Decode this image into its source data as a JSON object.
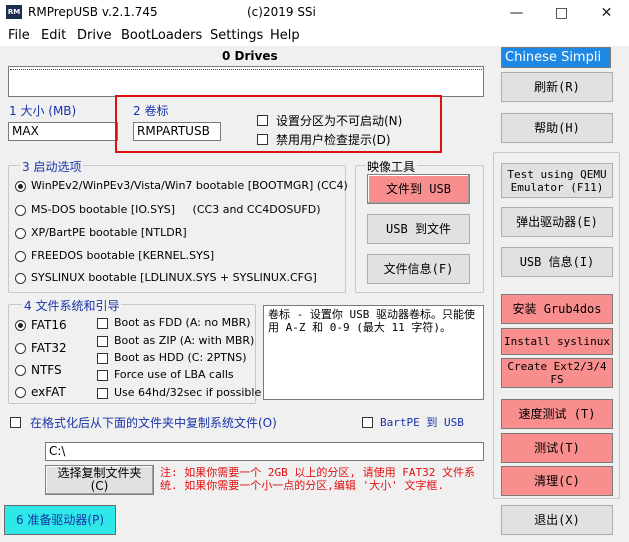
{
  "window": {
    "title": "RMPrepUSB v.2.1.745",
    "copyright": "(c)2019 SSi",
    "icon_text": "RM"
  },
  "menu": [
    "File",
    "Edit",
    "Drive",
    "BootLoaders",
    "Settings",
    "Help"
  ],
  "drives_label": "0 Drives",
  "language_select": "Chinese Simpli",
  "size": {
    "label": "1 大小 (MB)",
    "value": "MAX"
  },
  "volume": {
    "label": "2 卷标",
    "value": "RMPARTUSB"
  },
  "partition_options": {
    "non_bootable": "设置分区为不可启动(N)",
    "disable_prompts": "禁用用户检查提示(D)"
  },
  "boot_options": {
    "title": "3 启动选项",
    "items": [
      {
        "label": "WinPEv2/WinPEv3/Vista/Win7 bootable [BOOTMGR] (CC4)",
        "selected": true
      },
      {
        "label": "MS-DOS bootable [IO.SYS]     (CC3 and CC4DOSUFD)",
        "selected": false
      },
      {
        "label": "XP/BartPE bootable [NTLDR]",
        "selected": false
      },
      {
        "label": "FREEDOS bootable [KERNEL.SYS]",
        "selected": false
      },
      {
        "label": "SYSLINUX bootable [LDLINUX.SYS + SYSLINUX.CFG]",
        "selected": false
      }
    ]
  },
  "image_tools": {
    "title": "映像工具",
    "to_usb": "文件到 USB",
    "to_file": "USB 到文件",
    "file_info": "文件信息(F)"
  },
  "filesystem": {
    "title": "4 文件系统和引导",
    "types": [
      {
        "label": "FAT16",
        "selected": true
      },
      {
        "label": "FAT32",
        "selected": false
      },
      {
        "label": "NTFS",
        "selected": false
      },
      {
        "label": "exFAT",
        "selected": false
      }
    ],
    "checks": [
      "Boot as FDD (A: no MBR)",
      "Boot as ZIP (A: with MBR)",
      "Boot as HDD (C: 2PTNS)",
      "Force use of LBA calls",
      "Use 64hd/32sec if possible"
    ]
  },
  "help_text": "卷标 - 设置你 USB 驱动器卷标。只能使用 A-Z 和 0-9 (最大 11 字符)。",
  "copy_files": {
    "label": "在格式化后从下面的文件夹中复制系统文件(O)",
    "path": "C:\\",
    "choose_button": "选择复制文件夹",
    "choose_hotkey": "(C)"
  },
  "bartpe": "BartPE 到 USB",
  "note": "注: 如果你需要一个 2GB 以上的分区, 请使用 FAT32 文件系统. 如果你需要一个小一点的分区,编辑 '大小' 文字框.",
  "prepare_button": "6 准备驱动器(P)",
  "right_panel": {
    "refresh": "刷新(R)",
    "help": "帮助(H)",
    "test_qemu": "Test using QEMU Emulator (F11)",
    "eject": "弹出驱动器(E)",
    "usb_info": "USB 信息(I)",
    "install_grub": "安装 Grub4dos",
    "install_syslinux": "Install syslinux",
    "create_fs": "Create Ext2/3/4 FS",
    "speed_test": "速度测试 (T)",
    "test": "测试(T)",
    "clean": "清理(C)",
    "exit": "退出(X)"
  },
  "colors": {
    "highlight_border": "#e01010",
    "red_button": "#f88e8e",
    "prepare_button": "#2ee8e8",
    "label_blue": "#1a33a8"
  }
}
